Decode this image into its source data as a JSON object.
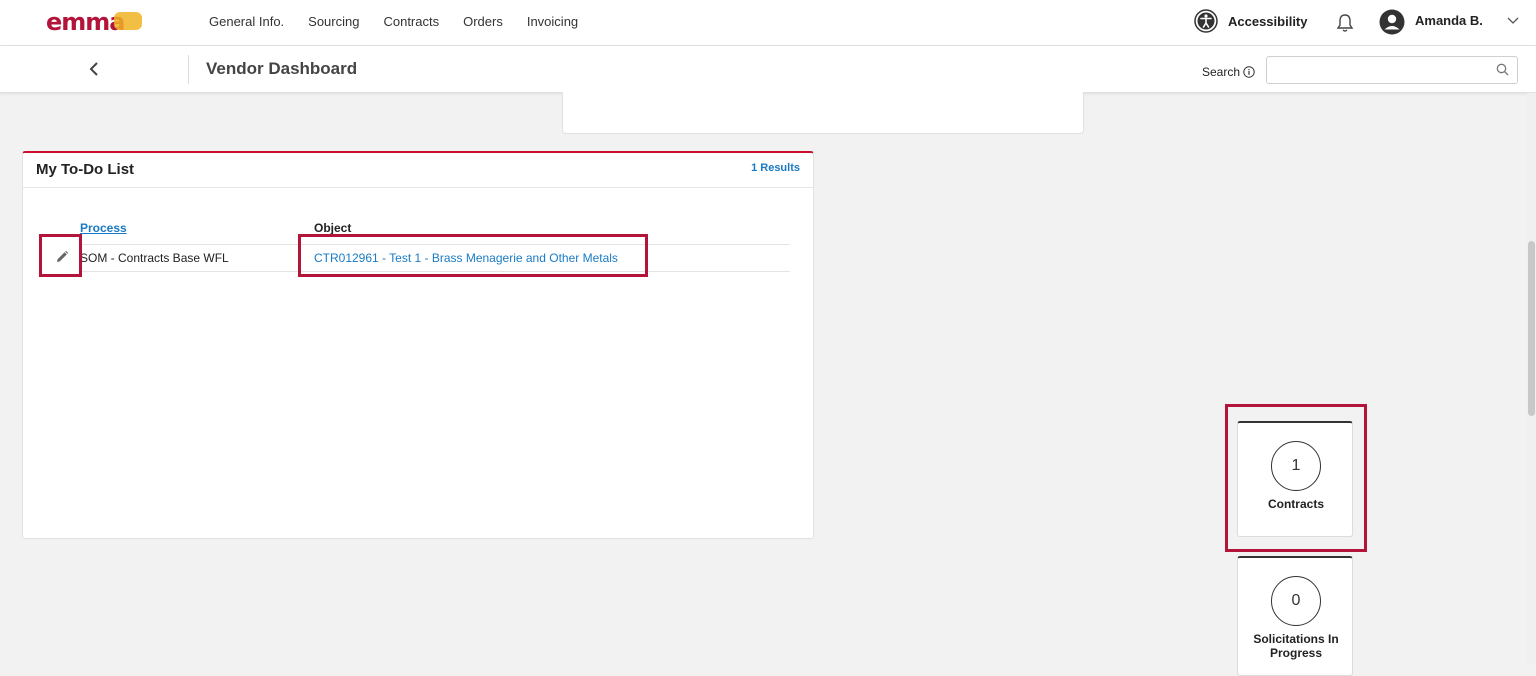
{
  "brand": {
    "logo_text": "emma"
  },
  "nav": {
    "items": [
      "General Info.",
      "Sourcing",
      "Contracts",
      "Orders",
      "Invoicing"
    ]
  },
  "topright": {
    "accessibility_label": "Accessibility",
    "user_name": "Amanda B."
  },
  "subheader": {
    "title": "Vendor Dashboard",
    "search_label": "Search",
    "search_value": ""
  },
  "todo": {
    "title": "My To-Do List",
    "results": "1 Results",
    "columns": {
      "process": "Process",
      "object": "Object"
    },
    "rows": [
      {
        "process": "SOM - Contracts Base WFL",
        "object": "CTR012961 - Test 1 - Brass Menagerie and Other Metals"
      }
    ]
  },
  "tiles": [
    {
      "count": "1",
      "label": "Contracts"
    },
    {
      "count": "0",
      "label": "Solicitations In Progress"
    }
  ],
  "colors": {
    "accent_red": "#c8102e",
    "highlight": "#b3143a",
    "link_blue": "#1a7bc4"
  }
}
